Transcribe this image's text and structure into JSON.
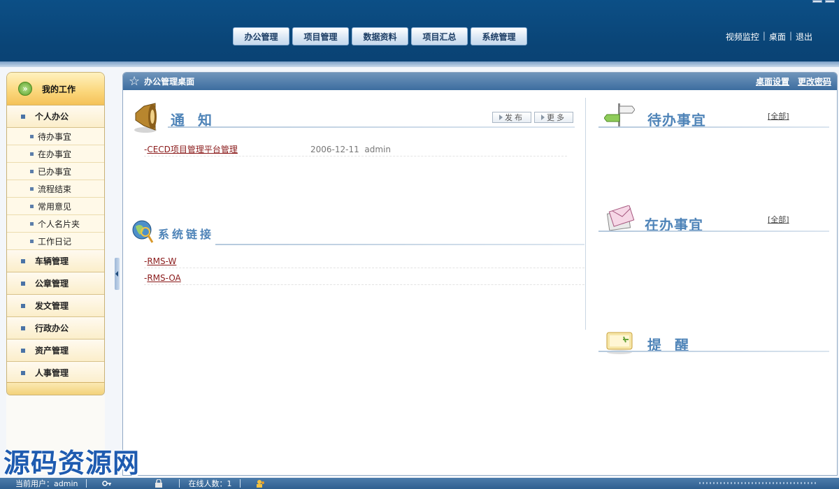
{
  "header": {
    "nav": [
      "办公管理",
      "项目管理",
      "数据资料",
      "项目汇总",
      "系统管理"
    ],
    "links": [
      "视频监控",
      "桌面",
      "退出"
    ]
  },
  "sidebar": {
    "title": "我的工作",
    "personal": {
      "label": "个人办公",
      "items": [
        "待办事宜",
        "在办事宜",
        "已办事宜",
        "流程结束",
        "常用意见",
        "个人名片夹",
        "工作日记"
      ]
    },
    "groups": [
      "车辆管理",
      "公章管理",
      "发文管理",
      "行政办公",
      "资产管理",
      "人事管理"
    ]
  },
  "main": {
    "title": "办公管理桌面",
    "links": [
      "桌面设置",
      "更改密码"
    ],
    "notice": {
      "title": "通 知",
      "buttons": [
        "发布",
        "更多"
      ],
      "items": [
        {
          "title": "CECD项目管理平台管理",
          "date": "2006-12-11",
          "author": "admin"
        }
      ]
    },
    "syslinks": {
      "title": "系统链接",
      "items": [
        "RMS-W",
        "RMS-OA"
      ]
    },
    "todo": {
      "title": "待办事宜",
      "all": "[全部]"
    },
    "inprogress": {
      "title": "在办事宜",
      "all": "[全部]"
    },
    "reminder": {
      "title": "提 醒"
    }
  },
  "statusbar": {
    "current_user": "当前用户：admin",
    "online": "在线人数：1"
  },
  "watermark": "源码资源网",
  "colors": {
    "header": "#0a4476",
    "accent": "#4f84b8",
    "sidebar": "#fbd67a",
    "link": "#8a1a1a"
  }
}
